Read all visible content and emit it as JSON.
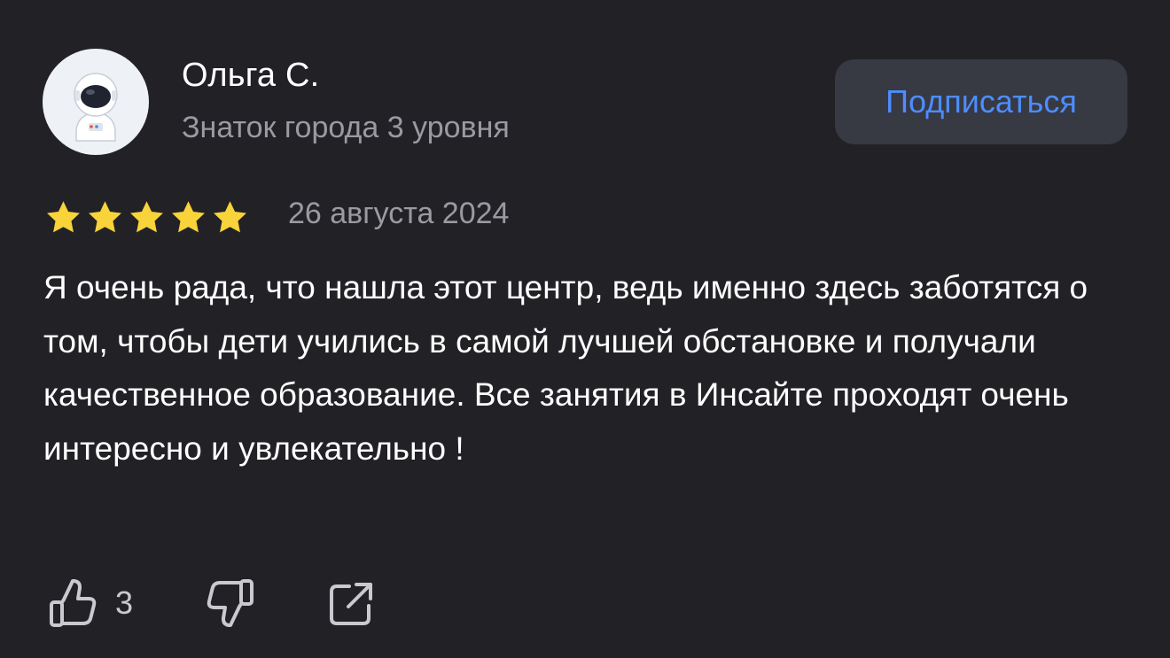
{
  "author": {
    "name": "Ольга С.",
    "level": "Знаток города 3 уровня",
    "avatar_icon": "astronaut-icon"
  },
  "subscribe": {
    "label": "Подписаться"
  },
  "review": {
    "rating": 5,
    "rating_max": 5,
    "date": "26 августа 2024",
    "text": "Я очень рада, что нашла этот центр, ведь именно здесь заботятся о том, чтобы дети учились в самой лучшей обстановке и получали качественное образование. Все занятия в Инсайте проходят очень интересно и увлекательно !"
  },
  "actions": {
    "like_count": "3",
    "like_icon": "thumbs-up-icon",
    "dislike_icon": "thumbs-down-icon",
    "share_icon": "share-icon"
  },
  "colors": {
    "background": "#222226",
    "star": "#f8d33a",
    "accent": "#4d8dff",
    "button_bg": "#373943",
    "secondary_text": "#9a9aa2"
  }
}
